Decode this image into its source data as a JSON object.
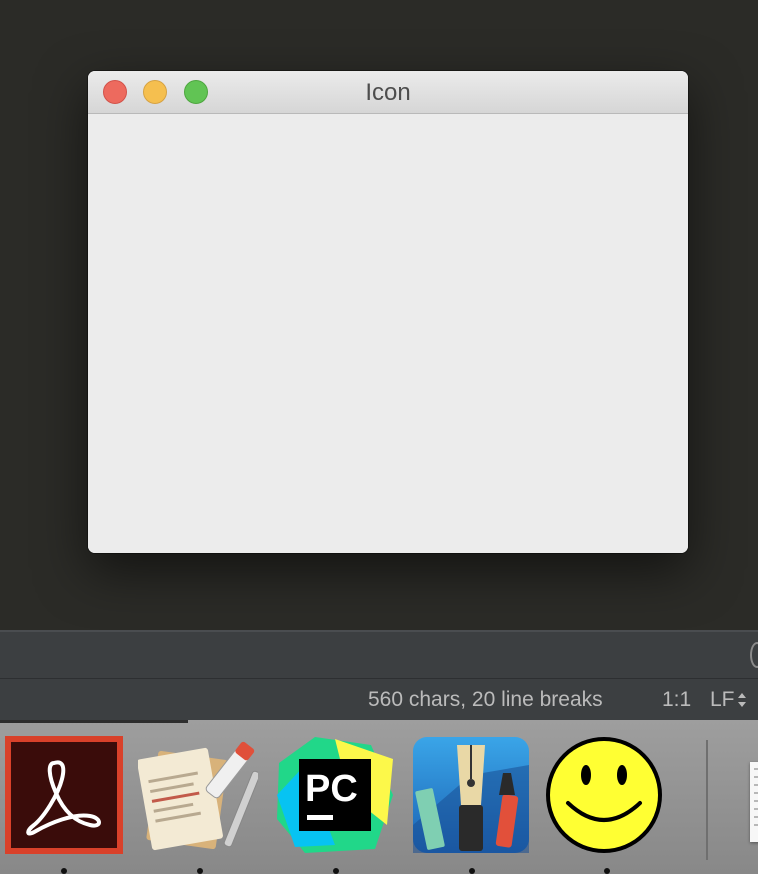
{
  "window": {
    "title": "Icon",
    "buttons": [
      "close",
      "minimize",
      "zoom"
    ]
  },
  "statusbar": {
    "chars_info": "560 chars, 20 line breaks",
    "caret_position": "1:1",
    "line_separator": "LF"
  },
  "dock": {
    "items": [
      {
        "name": "acrobat-reader-icon",
        "running": true
      },
      {
        "name": "textedit-icon",
        "running": true
      },
      {
        "name": "pycharm-icon",
        "label": "PC",
        "running": true
      },
      {
        "name": "vectornator-icon",
        "running": true
      },
      {
        "name": "smiley-icon",
        "running": true
      }
    ]
  },
  "colors": {
    "desktop": "#2b2b27",
    "window_bg": "#ececec",
    "close": "#ed6a5e",
    "minimize": "#f5bf4f",
    "zoom": "#61c454",
    "status_bg": "#3c3f41",
    "status_text": "#bbbbbb"
  }
}
